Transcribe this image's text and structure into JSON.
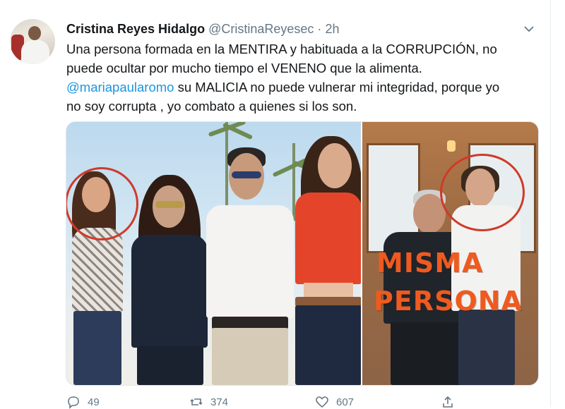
{
  "tweet": {
    "author_name": "Cristina Reyes Hidalgo",
    "author_handle": "@CristinaReyesec",
    "separator": "·",
    "time": "2h",
    "text_line1": "Una persona formada en la MENTIRA y habituada a la CORRUPCIÓN,  no",
    "text_line2": "puede ocultar por mucho tiempo el VENENO que la alimenta.",
    "mention": "@mariapaularomo",
    "text_line3_rest": " su MALICIA no puede vulnerar mi integridad, porque yo",
    "text_line4": "no soy corrupta , yo combato a quienes si los son."
  },
  "media": {
    "overlay_line1": "MISMA",
    "overlay_line2": "PERSONA",
    "highlight_color": "#cf3a2a",
    "overlay_color": "#ef5a1f"
  },
  "actions": {
    "reply_count": "49",
    "retweet_count": "374",
    "like_count": "607",
    "reply_icon": "reply-icon",
    "retweet_icon": "retweet-icon",
    "like_icon": "heart-icon",
    "share_icon": "share-icon"
  },
  "colors": {
    "link": "#1b95e0",
    "secondary_text": "#657786",
    "primary_text": "#14171a"
  }
}
